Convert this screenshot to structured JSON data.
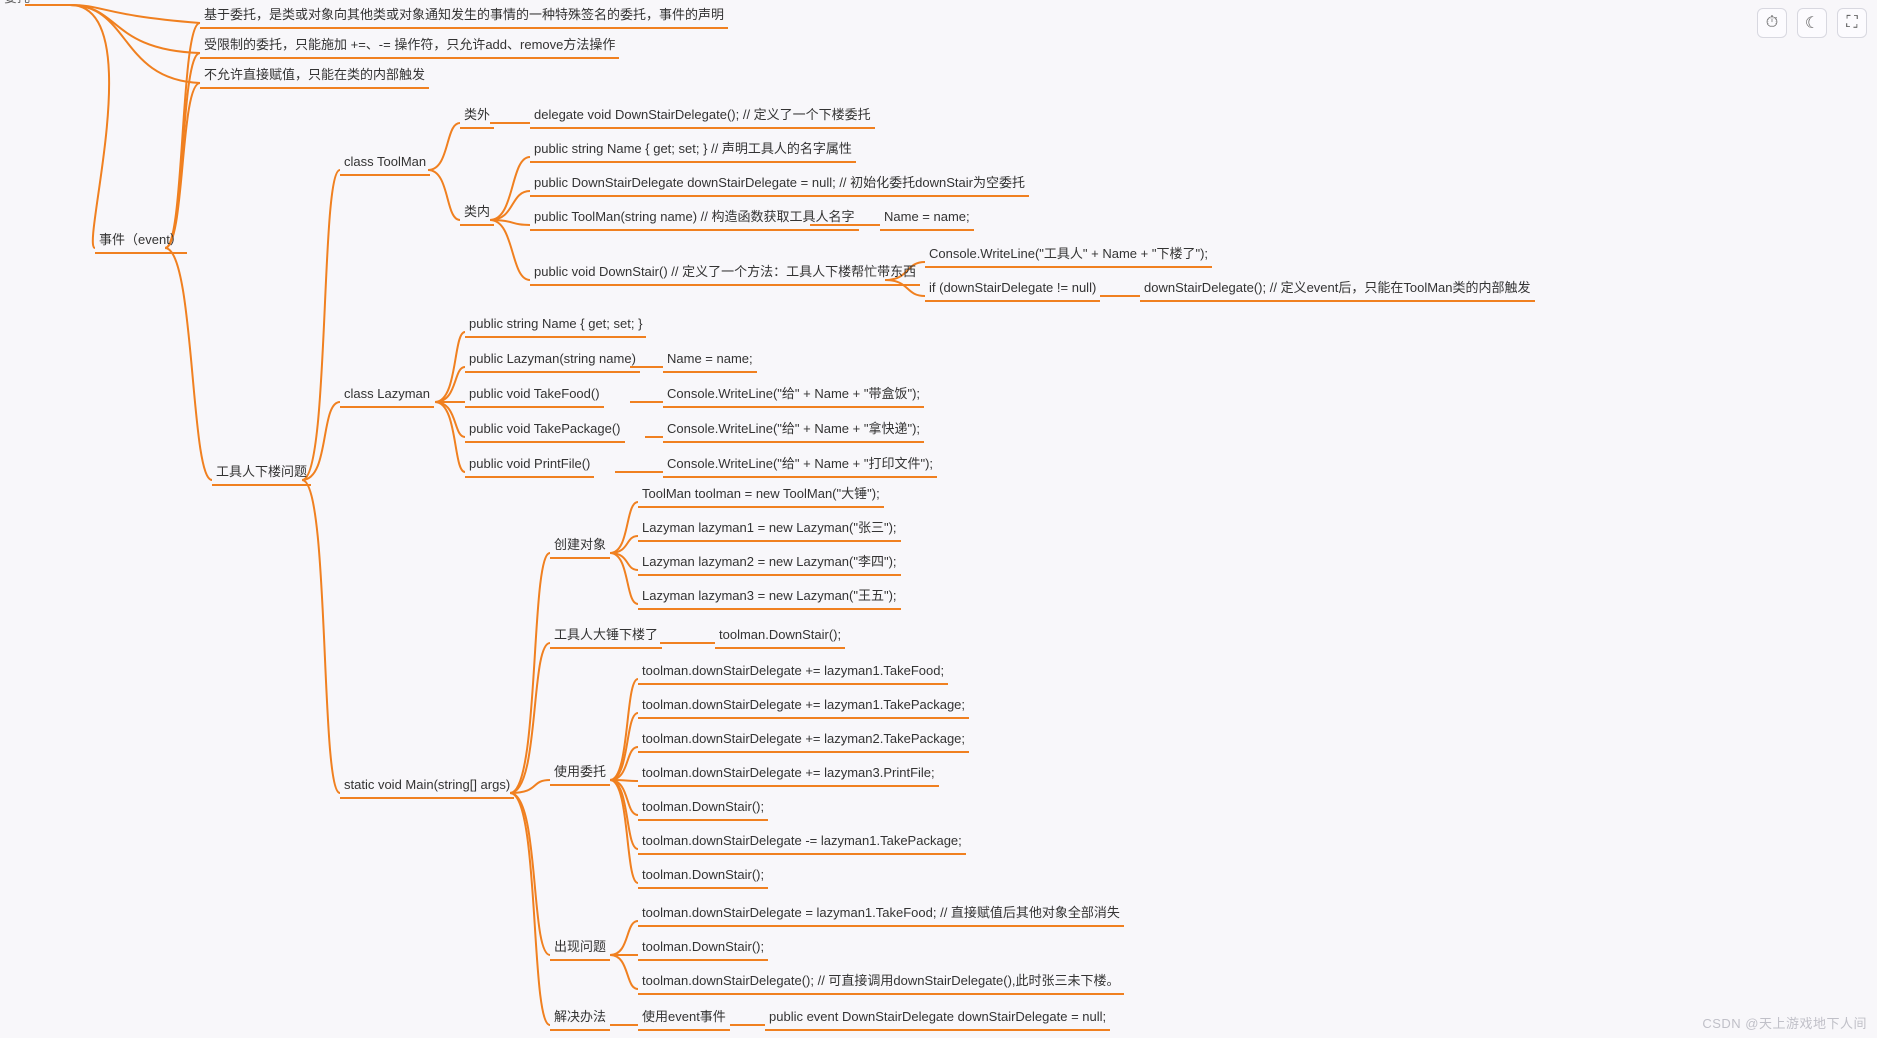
{
  "colors": {
    "branch": "#f08020",
    "bg": "#f8f7fa",
    "text": "#333333"
  },
  "root_partial": "委托",
  "event_label": "事件（event）",
  "event_children": [
    "基于委托，是类或对象向其他类或对象通知发生的事情的一种特殊签名的委托，事件的声明",
    "受限制的委托，只能施加 +=、-= 操作符，只允许add、remove方法操作",
    "不允许直接赋值，只能在类的内部触发"
  ],
  "example_label": "工具人下楼问题",
  "toolman": {
    "label": "class ToolMan",
    "outside": {
      "label": "类外",
      "code": "delegate void DownStairDelegate(); // 定义了一个下楼委托"
    },
    "inside": {
      "label": "类内",
      "lines": [
        "public string Name { get; set; } // 声明工具人的名字属性",
        "public DownStairDelegate downStairDelegate = null; // 初始化委托downStair为空委托"
      ],
      "ctor": {
        "code": "public ToolMan(string name) // 构造函数获取工具人名字",
        "body": "Name = name;"
      },
      "method": {
        "code": "public void DownStair() // 定义了一个方法：工具人下楼帮忙带东西",
        "body1": "Console.WriteLine(\"工具人\" + Name + \"下楼了\");",
        "body2a": "if (downStairDelegate != null)",
        "body2b": "downStairDelegate(); // 定义event后，只能在ToolMan类的内部触发"
      }
    }
  },
  "lazyman": {
    "label": "class Lazyman",
    "lines": [
      {
        "code": "public string Name { get; set; }"
      },
      {
        "code": "public Lazyman(string name)",
        "body": "Name = name;"
      },
      {
        "code": "public void TakeFood()",
        "body": "Console.WriteLine(\"给\" + Name + \"带盒饭\");"
      },
      {
        "code": "public void TakePackage()",
        "body": "Console.WriteLine(\"给\" + Name + \"拿快递\");"
      },
      {
        "code": "public void PrintFile()",
        "body": "Console.WriteLine(\"给\" + Name + \"打印文件\");"
      }
    ]
  },
  "main": {
    "label": "static void Main(string[] args)",
    "create": {
      "label": "创建对象",
      "lines": [
        "ToolMan toolman = new ToolMan(\"大锤\");",
        "Lazyman lazyman1 = new Lazyman(\"张三\");",
        "Lazyman lazyman2 = new Lazyman(\"李四\");",
        "Lazyman lazyman3 = new Lazyman(\"王五\");"
      ]
    },
    "go": {
      "label": "工具人大锤下楼了",
      "body": "toolman.DownStair();"
    },
    "use": {
      "label": "使用委托",
      "lines": [
        "toolman.downStairDelegate += lazyman1.TakeFood;",
        "toolman.downStairDelegate += lazyman1.TakePackage;",
        "toolman.downStairDelegate += lazyman2.TakePackage;",
        "toolman.downStairDelegate += lazyman3.PrintFile;",
        "toolman.DownStair();",
        "toolman.downStairDelegate -= lazyman1.TakePackage;",
        "toolman.DownStair();"
      ]
    },
    "problem": {
      "label": "出现问题",
      "lines": [
        "toolman.downStairDelegate = lazyman1.TakeFood; // 直接赋值后其他对象全部消失",
        "toolman.DownStair();",
        "toolman.downStairDelegate(); // 可直接调用downStairDelegate(),此时张三未下楼。"
      ]
    },
    "solve": {
      "label": "解决办法",
      "step": "使用event事件",
      "code": "public event DownStairDelegate downStairDelegate = null;"
    }
  },
  "toolbar": {
    "timer": "⏱",
    "theme": "☾",
    "fullscreen": "⛶"
  },
  "watermark": "CSDN @天上游戏地下人间"
}
